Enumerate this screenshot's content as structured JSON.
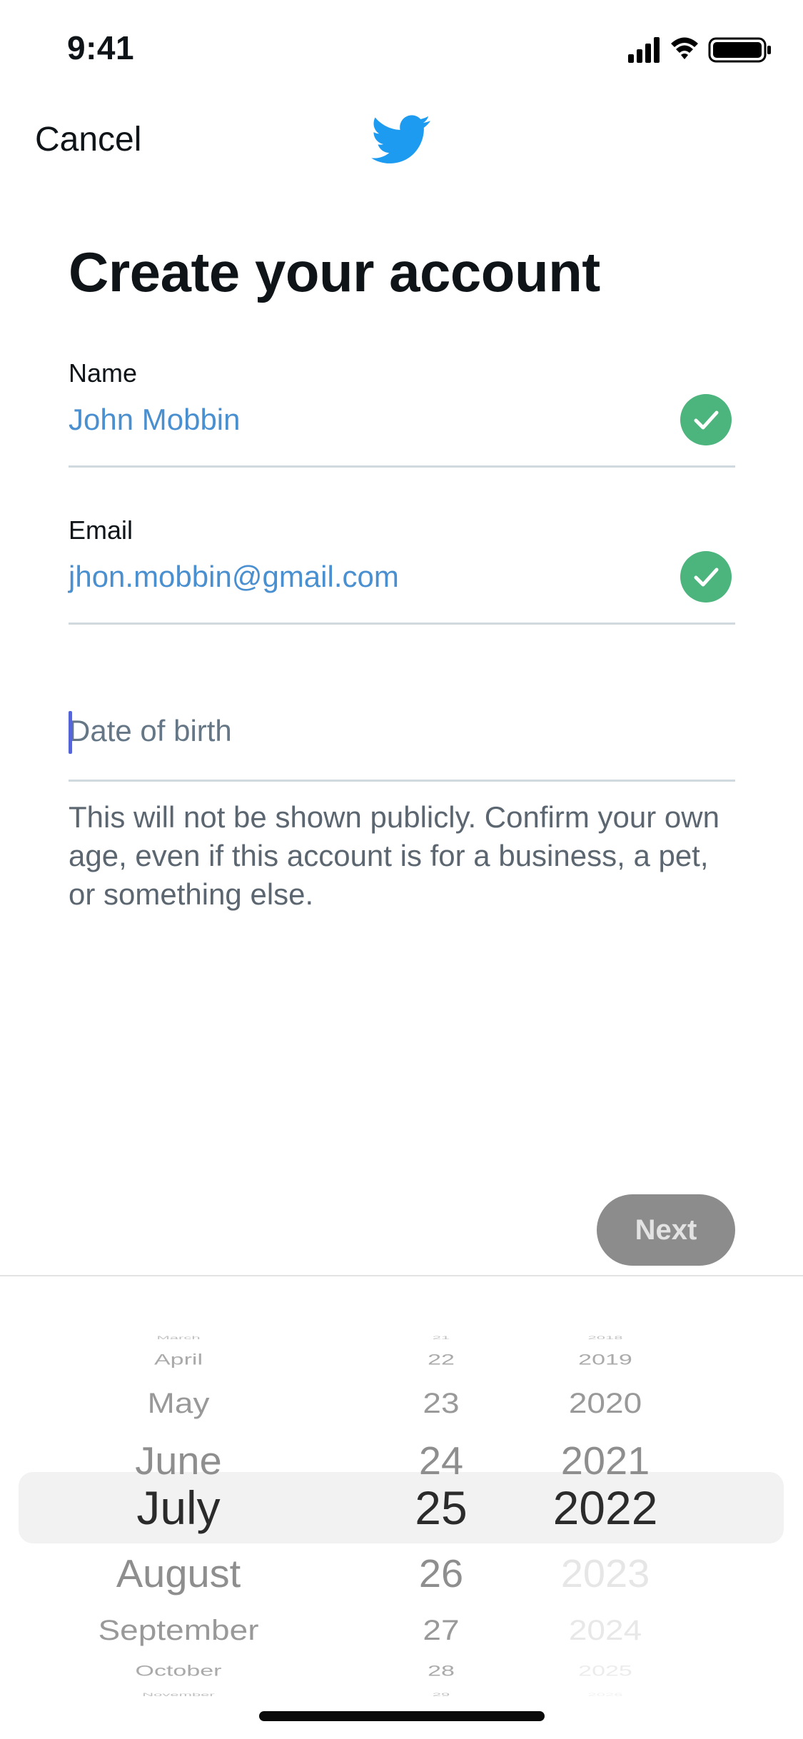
{
  "status_bar": {
    "time": "9:41"
  },
  "nav": {
    "cancel_label": "Cancel",
    "logo": "twitter-bird-icon"
  },
  "title": "Create your account",
  "form": {
    "name": {
      "label": "Name",
      "value": "John Mobbin",
      "valid": true
    },
    "email": {
      "label": "Email",
      "value": "jhon.mobbin@gmail.com",
      "valid": true
    },
    "dob": {
      "placeholder": "Date of birth",
      "help": "This will not be shown publicly. Confirm your own age, even if this account is for a business, a pet, or something else."
    }
  },
  "next_label": "Next",
  "picker": {
    "months": [
      "March",
      "April",
      "May",
      "June",
      "July",
      "August",
      "September",
      "October",
      "November"
    ],
    "days": [
      "21",
      "22",
      "23",
      "24",
      "25",
      "26",
      "27",
      "28",
      "29"
    ],
    "years": [
      "2018",
      "2019",
      "2020",
      "2021",
      "2022",
      "2023",
      "2024",
      "2025",
      "2026"
    ],
    "selected": {
      "month": "July",
      "day": "25",
      "year": "2022"
    }
  },
  "colors": {
    "accent": "#4a90d0",
    "check": "#4cb47d",
    "twitter_blue": "#1d9bf0",
    "button_disabled": "#8c8c8c"
  }
}
